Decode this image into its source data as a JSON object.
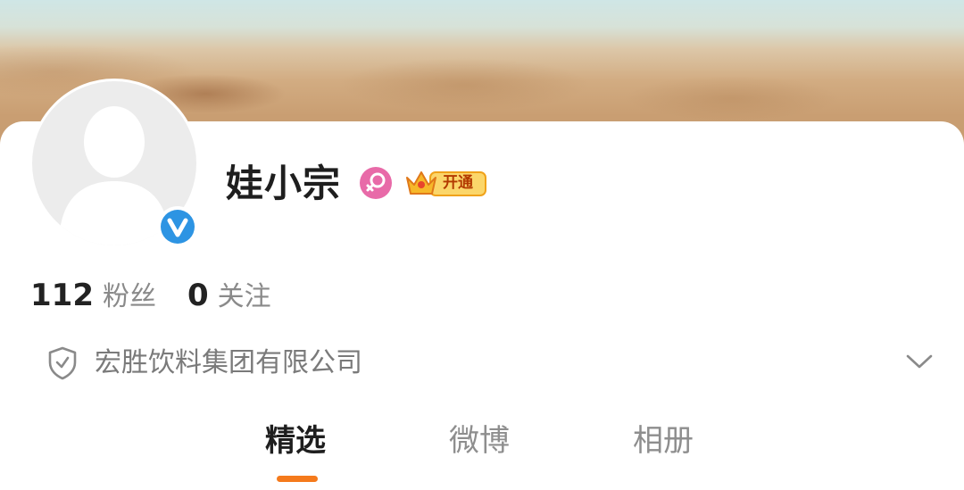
{
  "profile": {
    "name": "娃小宗",
    "vip_badge_text": "开通",
    "followers_count": "112",
    "followers_label": "粉丝",
    "following_count": "0",
    "following_label": "关注",
    "company": "宏胜饮料集团有限公司"
  },
  "tabs": [
    {
      "label": "精选",
      "active": true
    },
    {
      "label": "微博",
      "active": false
    },
    {
      "label": "相册",
      "active": false
    }
  ],
  "icons": {
    "avatar": "default-avatar-silhouette",
    "verified": "verified-v-icon",
    "gender": "female-icon",
    "vip": "vip-crown-icon",
    "company": "shield-check-icon",
    "expand": "chevron-down-icon"
  },
  "colors": {
    "accent": "#f57a1c",
    "verified_blue": "#2d94e3",
    "female_pink": "#e86aa8",
    "vip_gold": "#f6b82a"
  }
}
